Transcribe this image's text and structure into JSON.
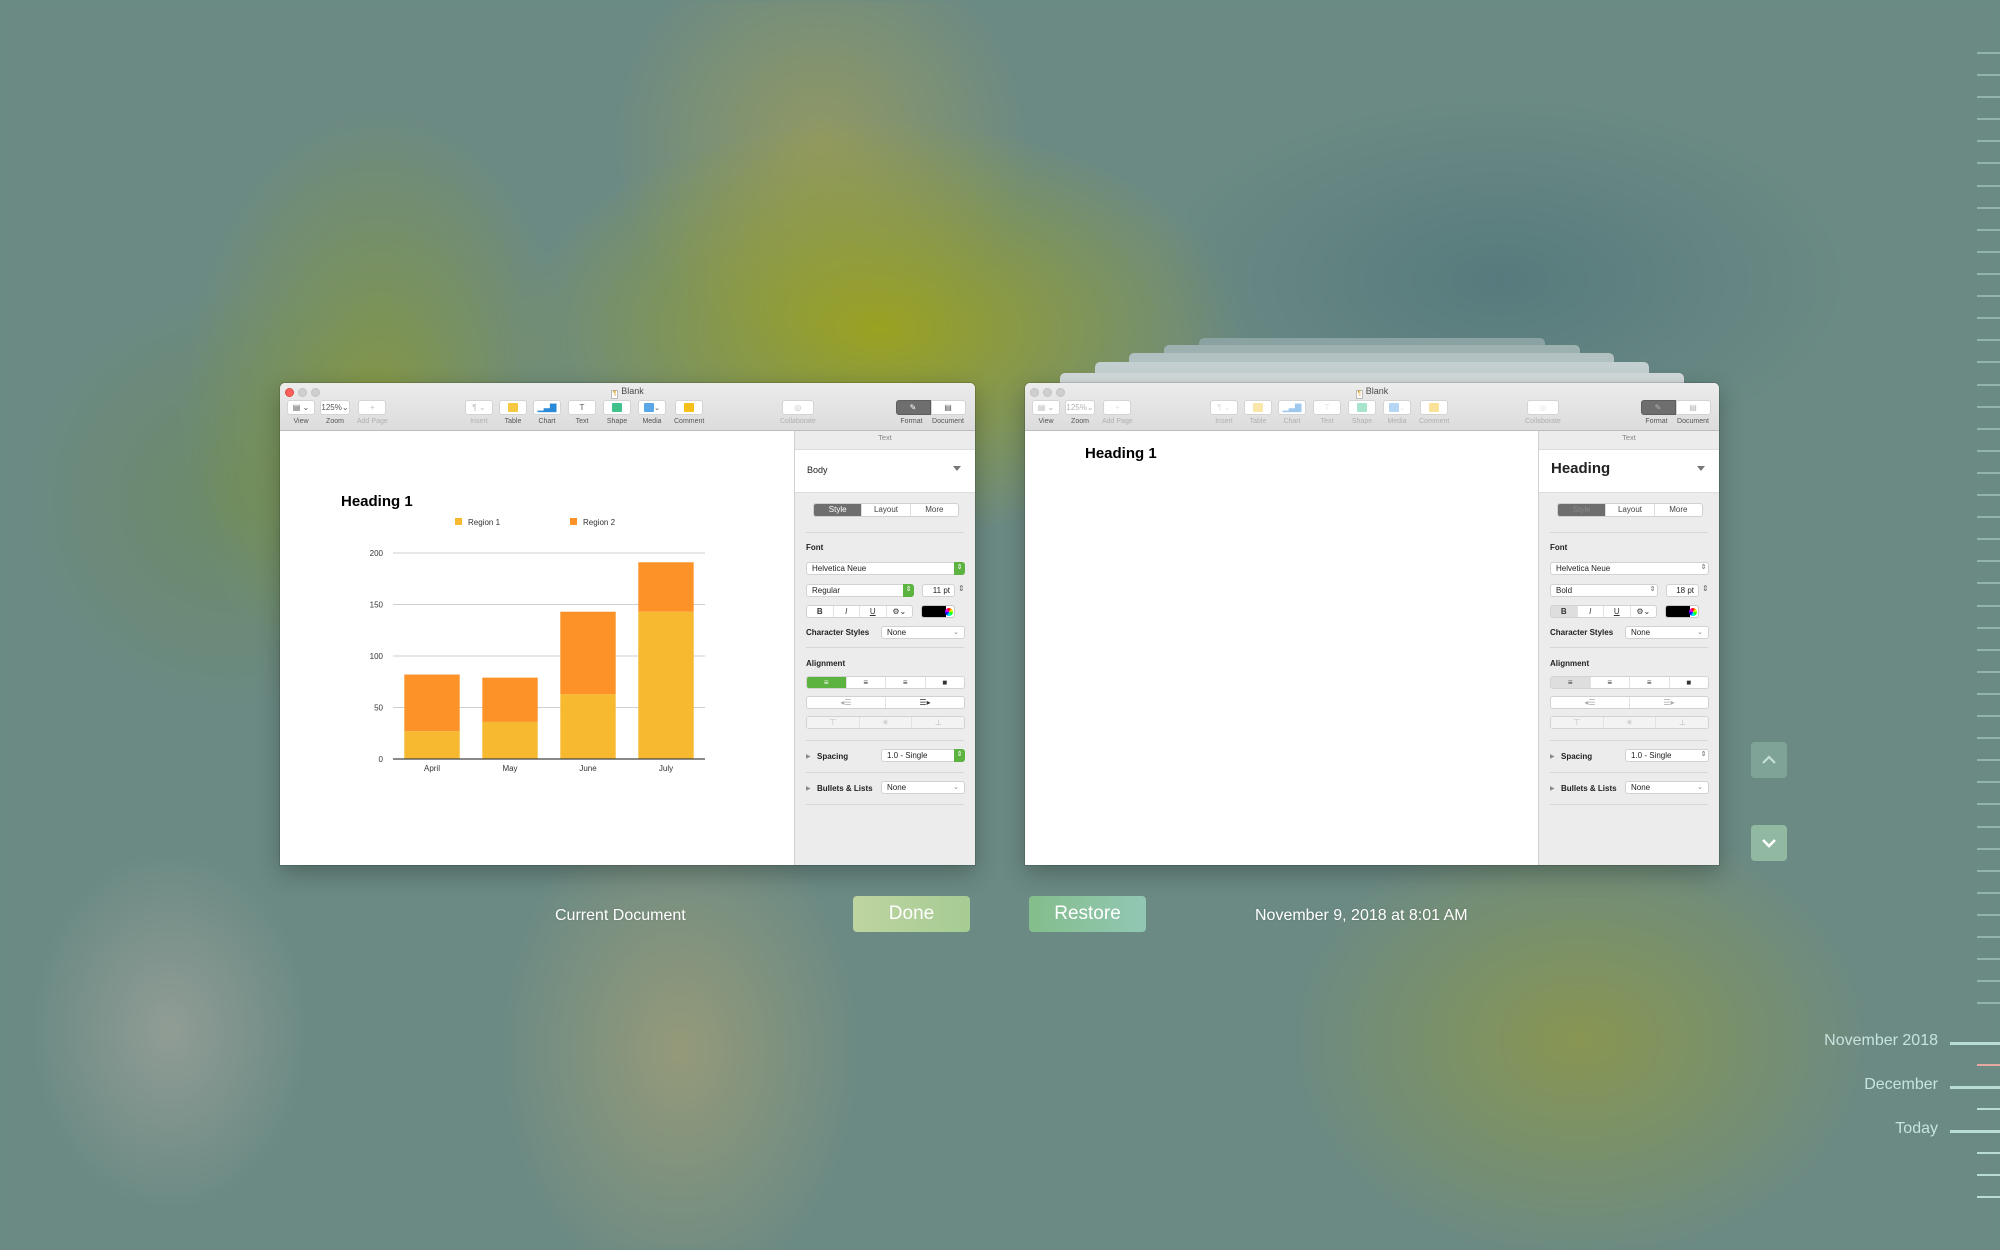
{
  "timemachine": {
    "current_caption": "Current Document",
    "done_label": "Done",
    "restore_label": "Restore",
    "version_caption": "November 9, 2018 at 8:01 AM",
    "nav": {
      "up_icon": "chevron-up-icon",
      "down_icon": "chevron-down-icon"
    },
    "timeline": {
      "labels": [
        "November 2018",
        "December",
        "Today"
      ],
      "accent_color": "#e7a8a2"
    }
  },
  "toolbar": {
    "view": "View",
    "zoom": "Zoom",
    "zoom_value": "125%",
    "add_page": "Add Page",
    "insert": "Insert",
    "table": "Table",
    "chart": "Chart",
    "text": "Text",
    "shape": "Shape",
    "media": "Media",
    "comment": "Comment",
    "collaborate": "Collaborate",
    "format": "Format",
    "document": "Document"
  },
  "windows": {
    "current": {
      "title": "Blank",
      "heading": "Heading 1",
      "inspector": {
        "header": "Text",
        "paragraph_style": "Body",
        "tabs": [
          "Style",
          "Layout",
          "More"
        ],
        "font_label": "Font",
        "font_family": "Helvetica Neue",
        "font_typeface": "Regular",
        "font_size": "11 pt",
        "bold": "B",
        "italic": "I",
        "underline": "U",
        "text_color": "#000000",
        "char_styles_label": "Character Styles",
        "char_styles_value": "None",
        "alignment_label": "Alignment",
        "spacing_label": "Spacing",
        "spacing_value": "1.0 - Single",
        "bullets_label": "Bullets & Lists",
        "bullets_value": "None"
      }
    },
    "version": {
      "title": "Blank",
      "heading": "Heading 1",
      "inspector": {
        "header": "Text",
        "paragraph_style": "Heading",
        "tabs": [
          "Style",
          "Layout",
          "More"
        ],
        "font_label": "Font",
        "font_family": "Helvetica Neue",
        "font_typeface": "Bold",
        "font_size": "18 pt",
        "bold": "B",
        "italic": "I",
        "underline": "U",
        "text_color": "#000000",
        "char_styles_label": "Character Styles",
        "char_styles_value": "None",
        "alignment_label": "Alignment",
        "spacing_label": "Spacing",
        "spacing_value": "1.0 - Single",
        "bullets_label": "Bullets & Lists",
        "bullets_value": "None"
      }
    }
  },
  "chart_data": {
    "type": "bar",
    "stacked": true,
    "title": "",
    "categories": [
      "April",
      "May",
      "June",
      "July"
    ],
    "series": [
      {
        "name": "Region 1",
        "color": "#f6b92f",
        "values": [
          27,
          36,
          63,
          143
        ]
      },
      {
        "name": "Region 2",
        "color": "#fc9228",
        "values": [
          55,
          43,
          80,
          48
        ]
      }
    ],
    "xlabel": "",
    "ylabel": "",
    "ylim": [
      0,
      200
    ],
    "yticks": [
      0,
      50,
      100,
      150,
      200
    ],
    "grid": true,
    "legend": "top-center"
  }
}
